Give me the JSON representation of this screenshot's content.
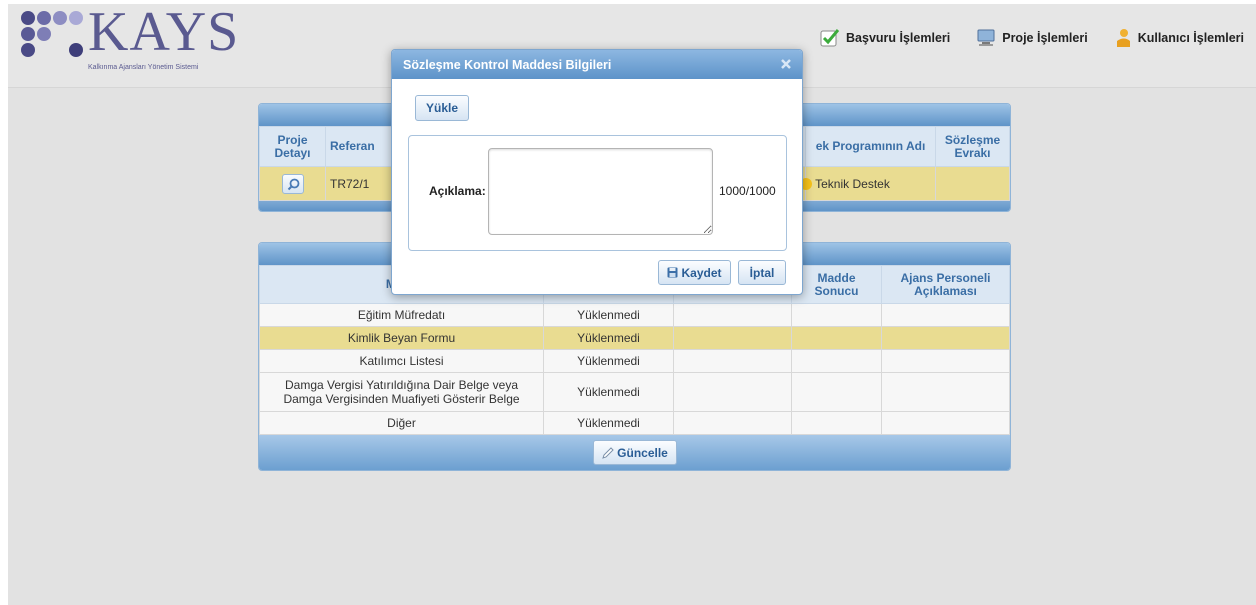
{
  "app": {
    "logo_text": "KAYS",
    "logo_subtitle": "Kalkınma Ajansları Yönetim Sistemi"
  },
  "nav": [
    {
      "label": "Başvuru İşlemleri",
      "icon": "check-icon"
    },
    {
      "label": "Proje İşlemleri",
      "icon": "computer-icon"
    },
    {
      "label": "Kullanıcı İşlemleri",
      "icon": "user-icon"
    }
  ],
  "project_table": {
    "headers": [
      "Proje Detayı",
      "Referan",
      "ek Programının Adı",
      "Sözleşme Evrakı"
    ],
    "row": {
      "reference": "TR72/1",
      "program": "Teknik Destek",
      "contract": ""
    }
  },
  "items_table": {
    "headers": [
      "Madd",
      "",
      "Madde Sonucu",
      "Ajans Personeli Açıklaması"
    ],
    "rows": [
      {
        "item": "Eğitim Müfredatı",
        "status": "Yüklenmedi",
        "c3": "",
        "c4": "",
        "c5": ""
      },
      {
        "item": "Kimlik Beyan Formu",
        "status": "Yüklenmedi",
        "c3": "",
        "c4": "",
        "c5": ""
      },
      {
        "item": "Katılımcı Listesi",
        "status": "Yüklenmedi",
        "c3": "",
        "c4": "",
        "c5": ""
      },
      {
        "item": "Damga Vergisi Yatırıldığına Dair Belge veya Damga Vergisinden Muafiyeti Gösterir Belge",
        "status": "Yüklenmedi",
        "c3": "",
        "c4": "",
        "c5": ""
      },
      {
        "item": "Diğer",
        "status": "Yüklenmedi",
        "c3": "",
        "c4": "",
        "c5": ""
      }
    ],
    "update_label": "Güncelle"
  },
  "modal": {
    "title": "Sözleşme Kontrol Maddesi Bilgileri",
    "upload_label": "Yükle",
    "description_label": "Açıklama:",
    "description_value": "",
    "counter": "1000/1000",
    "save_label": "Kaydet",
    "cancel_label": "İptal"
  },
  "colors": {
    "accent": "#5f94c8",
    "header_text": "#3a6ea5",
    "highlight_row": "#e9dc91",
    "logo": "#5a5a90"
  }
}
